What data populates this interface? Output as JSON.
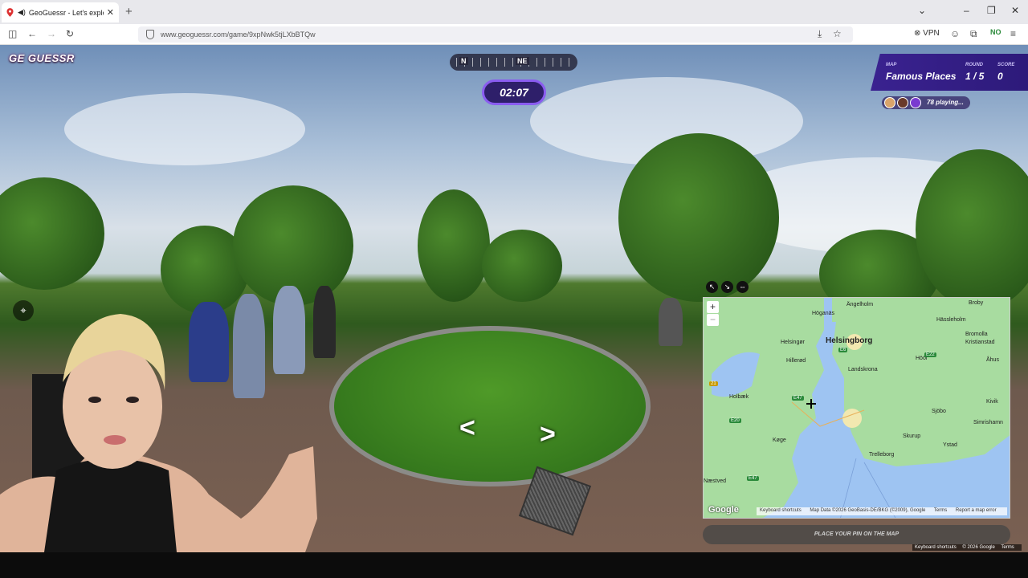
{
  "browser": {
    "tab_title": "GeoGuessr - Let's explore th",
    "url": "www.geoguessr.com/game/9xpNwk5tjLXbBTQw",
    "vpn_label": "VPN",
    "icons": [
      "geoguessr-favicon",
      "speaker-icon",
      "close-icon",
      "new-tab-icon",
      "chevron-down-icon",
      "minimize-icon",
      "maximize-icon",
      "close-window-icon",
      "sidebar-icon",
      "back-icon",
      "forward-icon",
      "reload-icon",
      "shield-icon",
      "save-icon",
      "star-icon",
      "account-icon",
      "extensions-icon",
      "menu-icon"
    ]
  },
  "game": {
    "logo": "GE GUESSR",
    "compass": {
      "left": "N",
      "right": "NE"
    },
    "timer": "02:07",
    "status": {
      "map_label": "MAP",
      "map_value": "Famous Places",
      "round_label": "ROUND",
      "round_value": "1 / 5",
      "score_label": "SCORE",
      "score_value": "0"
    },
    "players_text": "78 playing...",
    "nav_left": "<",
    "nav_right": ">",
    "place_pin_label": "PLACE YOUR PIN ON THE MAP"
  },
  "map": {
    "zoom_in": "+",
    "zoom_out": "−",
    "controls": [
      "expand-icon",
      "shrink-icon",
      "pin-icon"
    ],
    "places": [
      {
        "name": "Ängelholm"
      },
      {
        "name": "Broby"
      },
      {
        "name": "Höganäs"
      },
      {
        "name": "Hässleholm"
      },
      {
        "name": "Helsingør"
      },
      {
        "name": "Helsingborg",
        "big": true
      },
      {
        "name": "Bromolla"
      },
      {
        "name": "Kristianstad"
      },
      {
        "name": "Hillerød"
      },
      {
        "name": "Landskrona"
      },
      {
        "name": "Höör"
      },
      {
        "name": "Åhus"
      },
      {
        "name": "Holbæk"
      },
      {
        "name": "Kivik"
      },
      {
        "name": "Sjöbo"
      },
      {
        "name": "Simrishamn"
      },
      {
        "name": "Køge"
      },
      {
        "name": "Skurup"
      },
      {
        "name": "Ystad"
      },
      {
        "name": "Trelleborg"
      },
      {
        "name": "Næstved"
      }
    ],
    "roads": [
      {
        "label": "E6",
        "color": "#2a8a3a"
      },
      {
        "label": "E22",
        "color": "#2a8a3a"
      },
      {
        "label": "21",
        "color": "#c89a00"
      },
      {
        "label": "E47",
        "color": "#2a8a3a"
      },
      {
        "label": "E20",
        "color": "#2a8a3a"
      },
      {
        "label": "E47",
        "color": "#2a8a3a"
      }
    ],
    "google_logo": "Google",
    "attribution": {
      "shortcuts": "Keyboard shortcuts",
      "data": "Map Data ©2026 GeoBasis-DE/BKG (©2009), Google",
      "terms": "Terms",
      "report": "Report a map error"
    }
  },
  "footer": {
    "shortcuts": "Keyboard shortcuts",
    "copyright": "© 2026 Google",
    "terms": "Terms"
  }
}
